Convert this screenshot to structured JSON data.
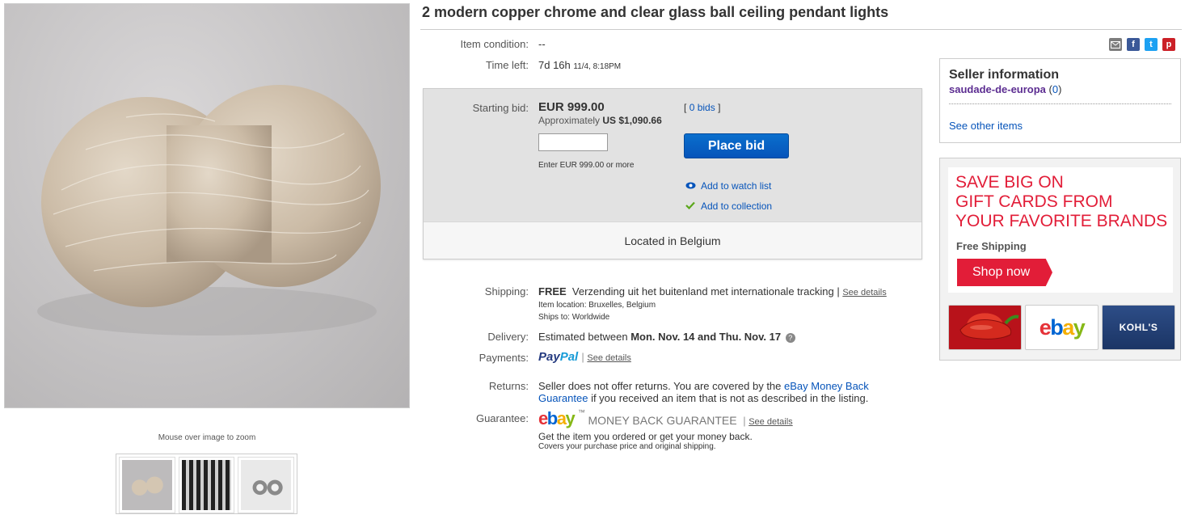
{
  "listing": {
    "title": "2 modern copper chrome and clear glass ball ceiling pendant lights",
    "zoom_hint": "Mouse over image to zoom"
  },
  "details": {
    "condition_label": "Item condition:",
    "condition_value": "--",
    "time_left_label": "Time left:",
    "time_left_value": "7d 16h",
    "time_left_end": "11/4, 8:18PM"
  },
  "bid": {
    "starting_label": "Starting bid:",
    "starting_value": "EUR 999.00",
    "approx_prefix": "Approximately",
    "approx_value": "US $1,090.66",
    "bids_open": "[",
    "bids_link": "0 bids",
    "bids_close": "]",
    "input_value": "",
    "enter_hint": "Enter EUR 999.00 or more",
    "place_bid": "Place bid",
    "watch_list": "Add to watch list",
    "collection": "Add to collection",
    "location": "Located in Belgium"
  },
  "shipping": {
    "label": "Shipping:",
    "free": "FREE",
    "method": "Verzending uit het buitenland met internationale tracking",
    "sep": "|",
    "see_details": "See details",
    "item_location": "Item location:  Bruxelles, Belgium",
    "ships_to": "Ships to:  Worldwide"
  },
  "delivery": {
    "label": "Delivery:",
    "prefix": "Estimated between",
    "range": "Mon. Nov. 14 and Thu. Nov. 17",
    "help_icon": "?"
  },
  "payments": {
    "label": "Payments:",
    "paypal_pay": "Pay",
    "paypal_pal": "Pal",
    "sep": "|",
    "see_details": "See details"
  },
  "returns": {
    "label": "Returns:",
    "line1_text": "Seller does not offer returns. You are covered by the",
    "line1_link": "eBay Money Back",
    "line2_link": "Guarantee",
    "line2_text": "if you received an item that is not as described in the listing."
  },
  "guarantee": {
    "label": "Guarantee:",
    "logo_e": "e",
    "logo_b": "b",
    "logo_a": "a",
    "logo_y": "y",
    "tm": "™",
    "mbg_text": "MONEY BACK GUARANTEE",
    "sep": "|",
    "see_details": "See details",
    "line1": "Get the item you ordered or get your money back.",
    "line2": "Covers your purchase price and original shipping."
  },
  "seller": {
    "heading": "Seller information",
    "name": "saudade-de-europa",
    "score_open": "(",
    "score": "0",
    "score_close": ")",
    "see_other": "See other items"
  },
  "ad": {
    "line1": "SAVE BIG ON",
    "line2": "GIFT CARDS FROM",
    "line3": "YOUR FAVORITE BRANDS",
    "free_shipping": "Free Shipping",
    "shop_now": "Shop now",
    "card_kohls": "KOHL'S",
    "card_ebay_e": "e",
    "card_ebay_b": "b",
    "card_ebay_a": "a",
    "card_ebay_y": "y"
  },
  "share": {
    "fb": "f",
    "tw": "t",
    "pin": "p"
  },
  "icons": [
    "mail-icon",
    "facebook-icon",
    "twitter-icon",
    "pinterest-icon",
    "eye-icon",
    "checkmark-icon",
    "help-icon"
  ],
  "colors": {
    "link": "#0654ba",
    "place_bid": "#0654ba",
    "seller_name": "#5c2d91",
    "ad_red": "#e21d38",
    "paypal_dark": "#253b80",
    "paypal_light": "#179bd7"
  }
}
